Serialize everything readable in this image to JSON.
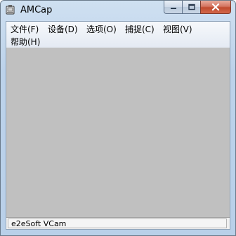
{
  "window": {
    "title": "AMCap",
    "app_icon": "webcam-app-icon",
    "frame_color": "#b9d0e9",
    "close_color": "#c7513a"
  },
  "menu": {
    "items": [
      {
        "label": "文件(F)"
      },
      {
        "label": "设备(D)"
      },
      {
        "label": "选项(O)"
      },
      {
        "label": "捕捉(C)"
      },
      {
        "label": "视图(V)"
      },
      {
        "label": "帮助(H)"
      }
    ]
  },
  "preview": {
    "background": "#c0c0c0"
  },
  "statusbar": {
    "text": "e2eSoft VCam"
  }
}
